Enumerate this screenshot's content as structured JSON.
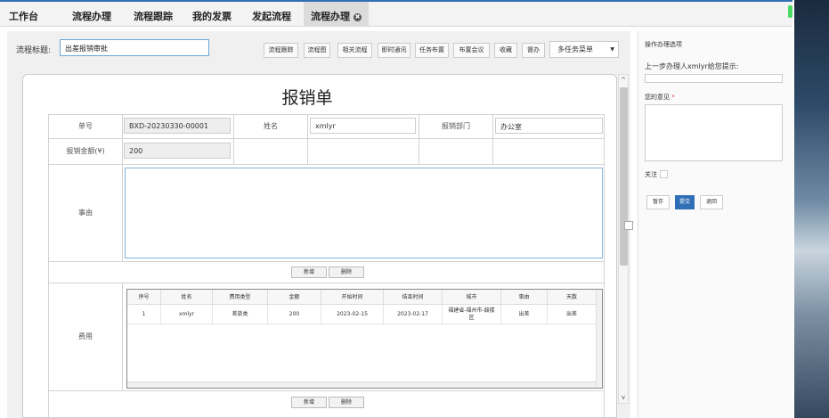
{
  "tabs": [
    {
      "label": "工作台"
    },
    {
      "label": "流程办理"
    },
    {
      "label": "流程跟踪"
    },
    {
      "label": "我的发票"
    },
    {
      "label": "发起流程"
    },
    {
      "label": "流程办理",
      "close": "✖"
    }
  ],
  "toolbar": {
    "title_label": "流程标题:",
    "title_value": "出差报销审批",
    "buttons": [
      "流程跟踪",
      "流程图",
      "相关流程",
      "即时通讯",
      "任务布置",
      "布置会议",
      "收藏",
      "督办"
    ],
    "menu": "多任务菜单",
    "menu_caret": "▼"
  },
  "form": {
    "title": "报销单",
    "labels": {
      "no": "单号",
      "name": "姓名",
      "dept": "报销部门",
      "amount": "报销金额(¥)",
      "reason": "事由",
      "expense": "费用"
    },
    "values": {
      "no": "BXD-20230330-00001",
      "name": "xmlyr",
      "dept": "办公室",
      "amount": "200"
    },
    "add": "新增",
    "del": "删除"
  },
  "grid": {
    "headers": [
      "序号",
      "姓名",
      "费用类型",
      "金额",
      "开始时间",
      "结束时间",
      "城市",
      "事由",
      "天数"
    ],
    "rows": [
      [
        "1",
        "xmlyr",
        "差旅类",
        "200",
        "2023-02-15",
        "2023-02-17",
        "福建省-福州市-鼓楼区",
        "出差",
        "出差"
      ]
    ]
  },
  "side": {
    "title": "操作办理选项",
    "prev_hint": "上一步办理人xmlyr给您提示:",
    "opinion_label": "您的意见",
    "required": "*",
    "follow_label": "关注",
    "save": "暂存",
    "submit": "提交",
    "back": "退回"
  },
  "scroll": {
    "up": "^",
    "down": "v"
  }
}
